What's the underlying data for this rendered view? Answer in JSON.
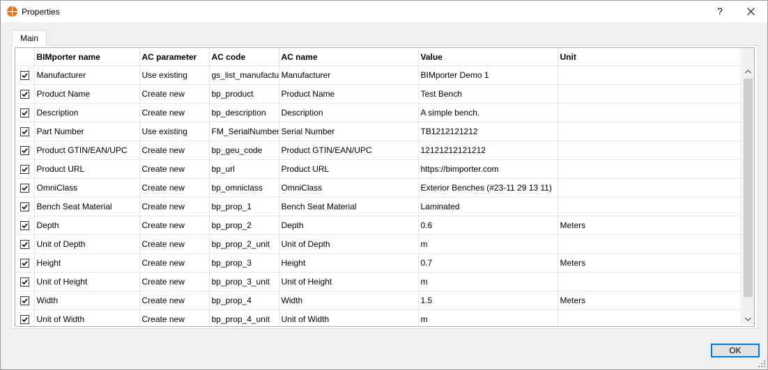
{
  "window": {
    "title": "Properties",
    "help_label": "?"
  },
  "tabs": [
    {
      "label": "Main"
    }
  ],
  "grid": {
    "columns": [
      "BIMporter name",
      "AC parameter",
      "AC code",
      "AC name",
      "Value",
      "Unit"
    ],
    "rows": [
      {
        "checked": true,
        "bimporter_name": "Manufacturer",
        "ac_parameter": "Use existing",
        "ac_code": "gs_list_manufacturer",
        "ac_name": "Manufacturer",
        "value": "BIMporter Demo 1",
        "unit": ""
      },
      {
        "checked": true,
        "bimporter_name": "Product Name",
        "ac_parameter": "Create new",
        "ac_code": "bp_product",
        "ac_name": "Product Name",
        "value": "Test Bench",
        "unit": ""
      },
      {
        "checked": true,
        "bimporter_name": "Description",
        "ac_parameter": "Create new",
        "ac_code": "bp_description",
        "ac_name": "Description",
        "value": "A simple bench.",
        "unit": ""
      },
      {
        "checked": true,
        "bimporter_name": "Part Number",
        "ac_parameter": "Use existing",
        "ac_code": "FM_SerialNumber",
        "ac_name": "Serial Number",
        "value": "TB1212121212",
        "unit": ""
      },
      {
        "checked": true,
        "bimporter_name": "Product GTIN/EAN/UPC",
        "ac_parameter": "Create new",
        "ac_code": "bp_geu_code",
        "ac_name": "Product GTIN/EAN/UPC",
        "value": "12121212121212",
        "unit": ""
      },
      {
        "checked": true,
        "bimporter_name": "Product URL",
        "ac_parameter": "Create new",
        "ac_code": "bp_url",
        "ac_name": "Product URL",
        "value": "https://bimporter.com",
        "unit": ""
      },
      {
        "checked": true,
        "bimporter_name": "OmniClass",
        "ac_parameter": "Create new",
        "ac_code": "bp_omniclass",
        "ac_name": "OmniClass",
        "value": "Exterior Benches (#23-11 29 13 11)",
        "unit": ""
      },
      {
        "checked": true,
        "bimporter_name": "Bench Seat Material",
        "ac_parameter": "Create new",
        "ac_code": "bp_prop_1",
        "ac_name": "Bench Seat Material",
        "value": "Laminated",
        "unit": ""
      },
      {
        "checked": true,
        "bimporter_name": "Depth",
        "ac_parameter": "Create new",
        "ac_code": "bp_prop_2",
        "ac_name": "Depth",
        "value": "0.6",
        "unit": "Meters"
      },
      {
        "checked": true,
        "bimporter_name": "Unit of Depth",
        "ac_parameter": "Create new",
        "ac_code": "bp_prop_2_unit",
        "ac_name": "Unit of Depth",
        "value": "m",
        "unit": ""
      },
      {
        "checked": true,
        "bimporter_name": "Height",
        "ac_parameter": "Create new",
        "ac_code": "bp_prop_3",
        "ac_name": "Height",
        "value": "0.7",
        "unit": "Meters"
      },
      {
        "checked": true,
        "bimporter_name": "Unit of Height",
        "ac_parameter": "Create new",
        "ac_code": "bp_prop_3_unit",
        "ac_name": "Unit of Height",
        "value": "m",
        "unit": ""
      },
      {
        "checked": true,
        "bimporter_name": "Width",
        "ac_parameter": "Create new",
        "ac_code": "bp_prop_4",
        "ac_name": "Width",
        "value": "1.5",
        "unit": "Meters"
      },
      {
        "checked": true,
        "bimporter_name": "Unit of Width",
        "ac_parameter": "Create new",
        "ac_code": "bp_prop_4_unit",
        "ac_name": "Unit of Width",
        "value": "m",
        "unit": ""
      }
    ]
  },
  "buttons": {
    "ok_label": "OK"
  },
  "colors": {
    "accent": "#0078d7",
    "app_icon": "#f26b1d"
  }
}
